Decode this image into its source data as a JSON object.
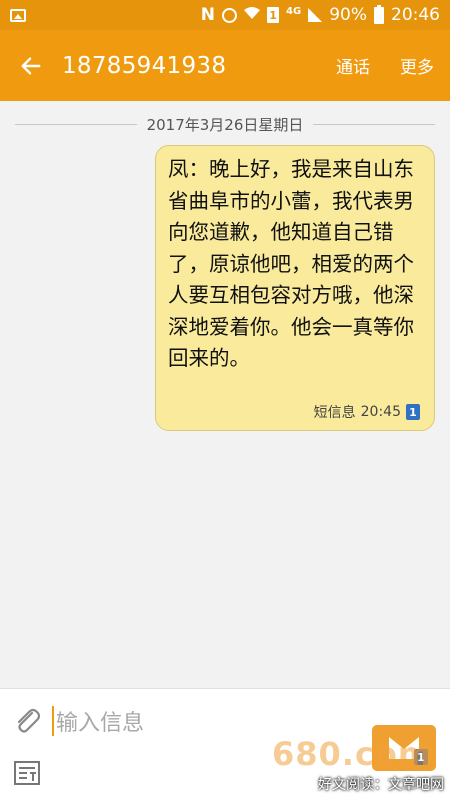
{
  "status_bar": {
    "network_letter": "N",
    "sim_number": "1",
    "network_type": "4G",
    "battery": "90%",
    "time": "20:46"
  },
  "app_bar": {
    "title": "18785941938",
    "call_label": "通话",
    "more_label": "更多"
  },
  "conversation": {
    "date": "2017年3月26日星期日",
    "messages": [
      {
        "text": "凤：晚上好，我是来自山东省曲阜市的小蕾，我代表男向您道歉，他知道自己错了，原谅他吧，相爱的两个人要互相包容对方哦，他深深地爱着你。他会一真等你回来的。",
        "type_label": "短信息",
        "time": "20:45",
        "sim": "1"
      }
    ]
  },
  "composer": {
    "placeholder": "输入信息",
    "send_sim": "1"
  },
  "watermark": {
    "big": "680.com",
    "small": "好文阅读：文章吧网"
  },
  "colors": {
    "accent": "#f09a10",
    "bubble": "#faeb9c",
    "sim_badge": "#2f72c4"
  }
}
